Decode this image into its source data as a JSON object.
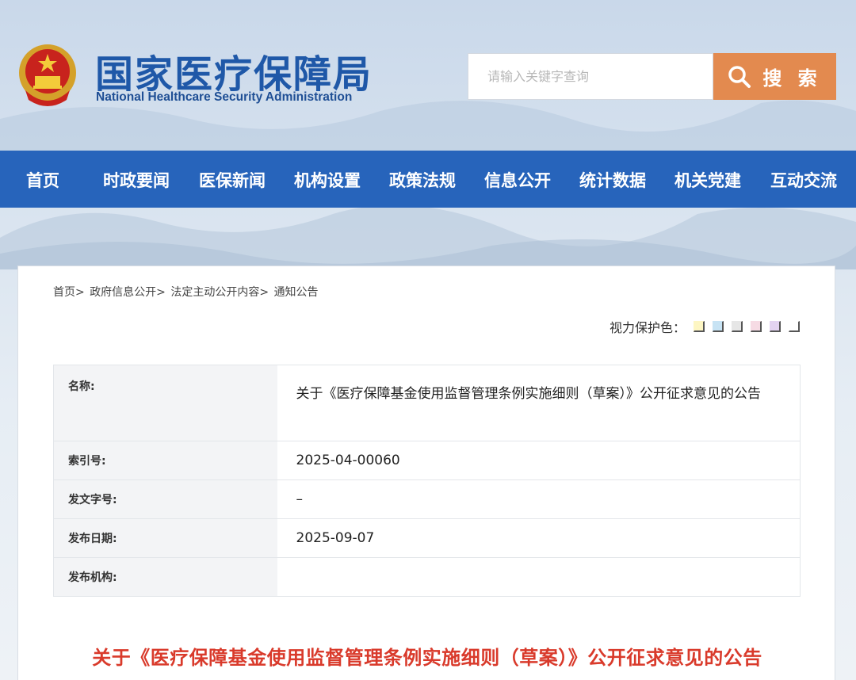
{
  "header": {
    "title": "国家医疗保障局",
    "subtitle": "National Healthcare Security Administration"
  },
  "search": {
    "placeholder": "请输入关键字查询",
    "button_label": "搜 索"
  },
  "nav": {
    "items": [
      "首页",
      "时政要闻",
      "医保新闻",
      "机构设置",
      "政策法规",
      "信息公开",
      "统计数据",
      "机关党建",
      "互动交流"
    ]
  },
  "breadcrumb": {
    "items": [
      "首页>",
      "政府信息公开>",
      "法定主动公开内容>",
      "通知公告"
    ]
  },
  "eye_protect": {
    "label": "视力保护色：",
    "colors": [
      "#fdf6c3",
      "#c7e3f4",
      "#e6e6e6",
      "#f6dbe4",
      "#e3d3f1",
      "#ffffff"
    ]
  },
  "meta": {
    "rows": [
      {
        "label": "名称:",
        "value": "关于《医疗保障基金使用监督管理条例实施细则（草案）》公开征求意见的公告"
      },
      {
        "label": "索引号:",
        "value": "2025-04-00060"
      },
      {
        "label": "发文字号:",
        "value": "–"
      },
      {
        "label": "发布日期:",
        "value": "2025-09-07"
      },
      {
        "label": "发布机构:",
        "value": ""
      }
    ]
  },
  "article": {
    "title": "关于《医疗保障基金使用监督管理条例实施细则（草案）》公开征求意见的公告"
  },
  "colors": {
    "nav_bg": "#2764bb",
    "title_blue": "#1f58a8",
    "search_button": "#e38a4f",
    "article_title": "#d93a2b"
  }
}
